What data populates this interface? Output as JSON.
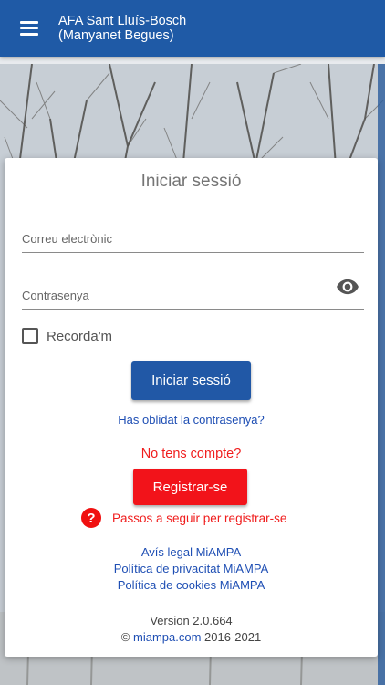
{
  "appbar": {
    "title_line1": "AFA Sant Lluís-Bosch",
    "title_line2": "(Manyanet Begues)",
    "menu_icon": "hamburger-menu-icon"
  },
  "login": {
    "title": "Iniciar sessió",
    "email_placeholder": "Correu electrònic",
    "password_placeholder": "Contrasenya",
    "password_toggle_icon": "eye-icon",
    "remember_label": "Recorda'm",
    "remember_checked": false,
    "submit_label": "Iniciar sessió",
    "forgot_label": "Has oblidat la contrasenya?"
  },
  "register": {
    "prompt": "No tens compte?",
    "button_label": "Registrar-se",
    "help_icon": "question-circle-icon",
    "steps_label": "Passos a seguir per registrar-se"
  },
  "legal": {
    "notice": "Avís legal MiAMPA",
    "privacy": "Política de privacitat MiAMPA",
    "cookies": "Política de cookies MiAMPA"
  },
  "footer": {
    "version": "Version 2.0.664",
    "copyright_symbol": "©",
    "site": "miampa.com",
    "years": "2016-2021"
  },
  "colors": {
    "appbar": "#1f5aa6",
    "primary_button": "#2158a6",
    "register_button": "#f2131a",
    "link": "#1f4fb4",
    "alert_text": "#f01d1d"
  }
}
